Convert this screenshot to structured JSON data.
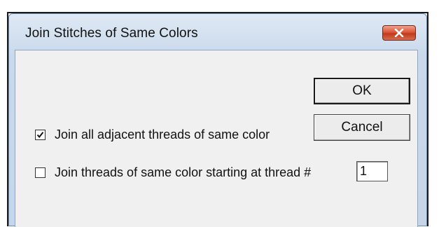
{
  "window": {
    "title": "Join Stitches of Same Colors"
  },
  "buttons": {
    "ok_label": "OK",
    "cancel_label": "Cancel"
  },
  "options": [
    {
      "label": "Join all adjacent threads of same color",
      "checked": true
    },
    {
      "label": "Join threads of same color starting at thread #",
      "checked": false
    }
  ],
  "thread_number": {
    "value": "1"
  },
  "icons": {
    "close": "close-icon",
    "check": "checkmark-icon"
  },
  "colors": {
    "close_button": "#c9452a",
    "titlebar": "#c9d9eb",
    "client_background": "#f0f0f0"
  }
}
